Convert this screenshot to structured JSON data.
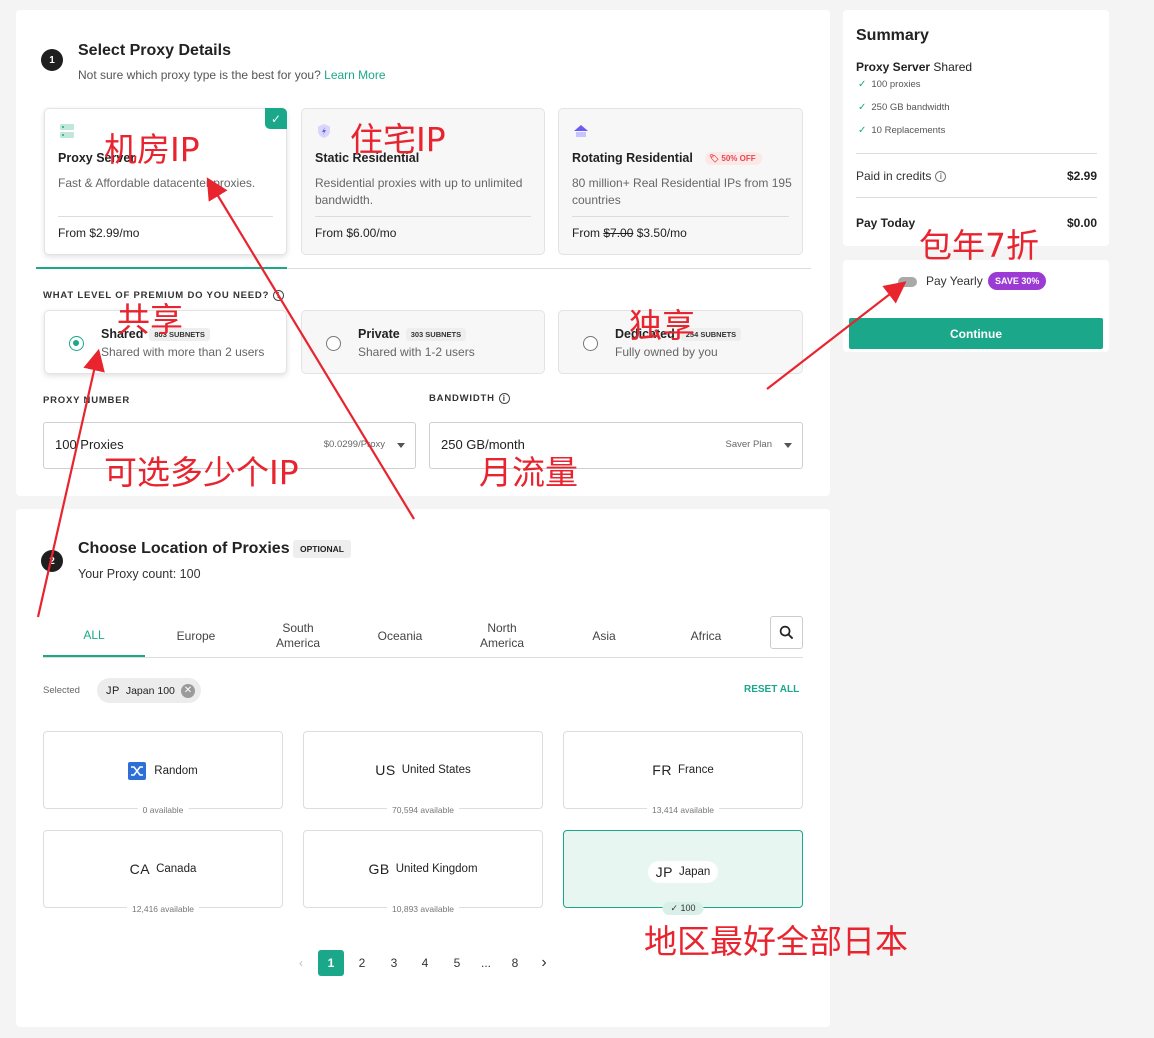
{
  "step1": {
    "number": "1",
    "title": "Select Proxy Details",
    "subtitle": "Not sure which proxy type is the best for you?",
    "learn_more": "Learn More",
    "products": [
      {
        "title": "Proxy Server",
        "desc": "Fast & Affordable datacenter proxies.",
        "price": "From $2.99/mo",
        "icon": "server-icon"
      },
      {
        "title": "Static Residential",
        "desc": "Residential proxies with up to unlimited bandwidth.",
        "price": "From $6.00/mo",
        "icon": "shield-icon"
      },
      {
        "title": "Rotating Residential",
        "badge": "50% OFF",
        "desc": "80 million+ Real Residential IPs from 195 countries",
        "price_prefix": "From",
        "price_old": "$7.00",
        "price_new": "$3.50/mo",
        "icon": "home-icon"
      }
    ],
    "premium_label": "WHAT LEVEL OF PREMIUM DO YOU NEED?",
    "premium_levels": [
      {
        "title": "Shared",
        "subnets": "803 SUBNETS",
        "desc": "Shared with more than 2 users",
        "selected": true
      },
      {
        "title": "Private",
        "subnets": "303 SUBNETS",
        "desc": "Shared with 1-2 users",
        "selected": false
      },
      {
        "title": "Dedicated",
        "subnets": "254 SUBNETS",
        "desc": "Fully owned by you",
        "selected": false
      }
    ],
    "proxy_number": {
      "label": "PROXY NUMBER",
      "value": "100 Proxies",
      "hint": "$0.0299/Proxy"
    },
    "bandwidth": {
      "label": "BANDWIDTH",
      "value": "250 GB/month",
      "hint": "Saver Plan"
    }
  },
  "step2": {
    "number": "2",
    "title": "Choose Location of Proxies",
    "optional": "OPTIONAL",
    "proxy_count": "Your Proxy count: 100",
    "tabs": [
      "ALL",
      "Europe",
      "South America",
      "Oceania",
      "North America",
      "Asia",
      "Africa"
    ],
    "selected_label": "Selected",
    "chip": {
      "code": "JP",
      "name": "Japan",
      "count": "100"
    },
    "reset": "RESET ALL",
    "locations": [
      {
        "code": "",
        "name": "Random",
        "available": "0 available"
      },
      {
        "code": "US",
        "name": "United States",
        "available": "70,594 available"
      },
      {
        "code": "FR",
        "name": "France",
        "available": "13,414 available"
      },
      {
        "code": "CA",
        "name": "Canada",
        "available": "12,416 available"
      },
      {
        "code": "GB",
        "name": "United Kingdom",
        "available": "10,893 available"
      },
      {
        "code": "JP",
        "name": "Japan",
        "selected_count": "100"
      }
    ],
    "pagination": [
      "1",
      "2",
      "3",
      "4",
      "5",
      "...",
      "8"
    ]
  },
  "summary": {
    "title": "Summary",
    "product": "Proxy Server",
    "level": "Shared",
    "features": [
      "100 proxies",
      "250 GB bandwidth",
      "10 Replacements"
    ],
    "paid_credits_label": "Paid in credits",
    "paid_credits_value": "$2.99",
    "pay_today_label": "Pay Today",
    "pay_today_value": "$0.00",
    "pay_yearly": "Pay Yearly",
    "save_badge": "SAVE 30%",
    "continue": "Continue"
  },
  "annotations": [
    "机房IP",
    "住宅IP",
    "共享",
    "独享",
    "可选多少个IP",
    "月流量",
    "包年7折",
    "地区最好全部日本"
  ],
  "colors": {
    "accent": "#1aa78a",
    "annotation": "#e8242f",
    "save_badge": "#9b3bd4"
  }
}
